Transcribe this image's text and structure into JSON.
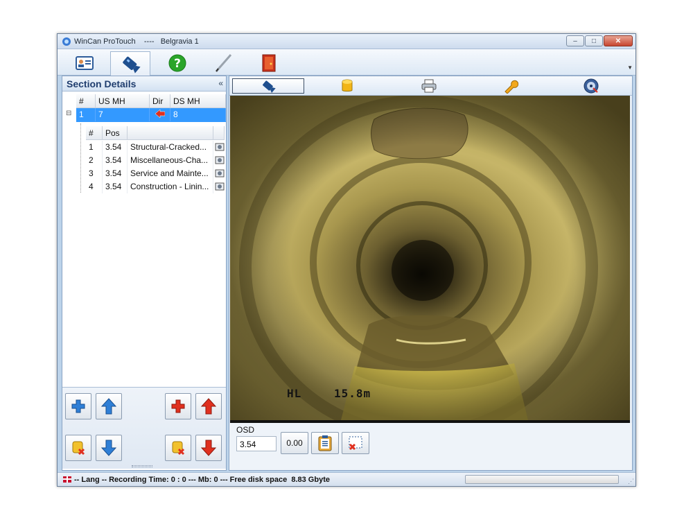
{
  "window": {
    "title": "WinCan ProTouch    ----   Belgravia 1",
    "controls": [
      "–",
      "□",
      "✕"
    ]
  },
  "toolbar": {
    "items": [
      "contacts-card-icon",
      "video-camera-icon",
      "help-icon",
      "pen-icon",
      "exit-door-icon"
    ],
    "active_index": 1
  },
  "section_details": {
    "title": "Section Details",
    "collapse_glyph": "«",
    "sections_columns": [
      "#",
      "US MH",
      "Dir",
      "DS MH"
    ],
    "sections_rows": [
      {
        "num": "1",
        "us_mh": "7",
        "dir_icon": "red-left-arrow-icon",
        "ds_mh": "8"
      }
    ],
    "tree_toggle": "⊟",
    "obs_columns": [
      "#",
      "Pos",
      ""
    ],
    "observations": [
      {
        "num": "1",
        "pos": "3.54",
        "desc": "Structural-Cracked..."
      },
      {
        "num": "2",
        "pos": "3.54",
        "desc": "Miscellaneous-Cha..."
      },
      {
        "num": "3",
        "pos": "3.54",
        "desc": "Service and Mainte..."
      },
      {
        "num": "4",
        "pos": "3.54",
        "desc": "Construction - Linin..."
      }
    ]
  },
  "right_tabs": [
    "video-camera-icon",
    "database-icon",
    "printer-icon",
    "wrench-icon",
    "disc-export-icon"
  ],
  "right_tabs_active": 0,
  "video": {
    "overlay_code": "HL",
    "overlay_distance": "15.8m"
  },
  "osd": {
    "label": "OSD",
    "value": "3.54",
    "button_value": "0.00"
  },
  "status": {
    "text": "-- Lang -- Recording Time: 0 : 0 --- Mb: 0 --- Free disk space  8.83 Gbyte",
    "progress": 0
  },
  "colors": {
    "selection": "#3399ff",
    "panel_header_text": "#1f3d6e",
    "arrow_blue": "#2f7fd6",
    "plus_red": "#e0301f"
  }
}
